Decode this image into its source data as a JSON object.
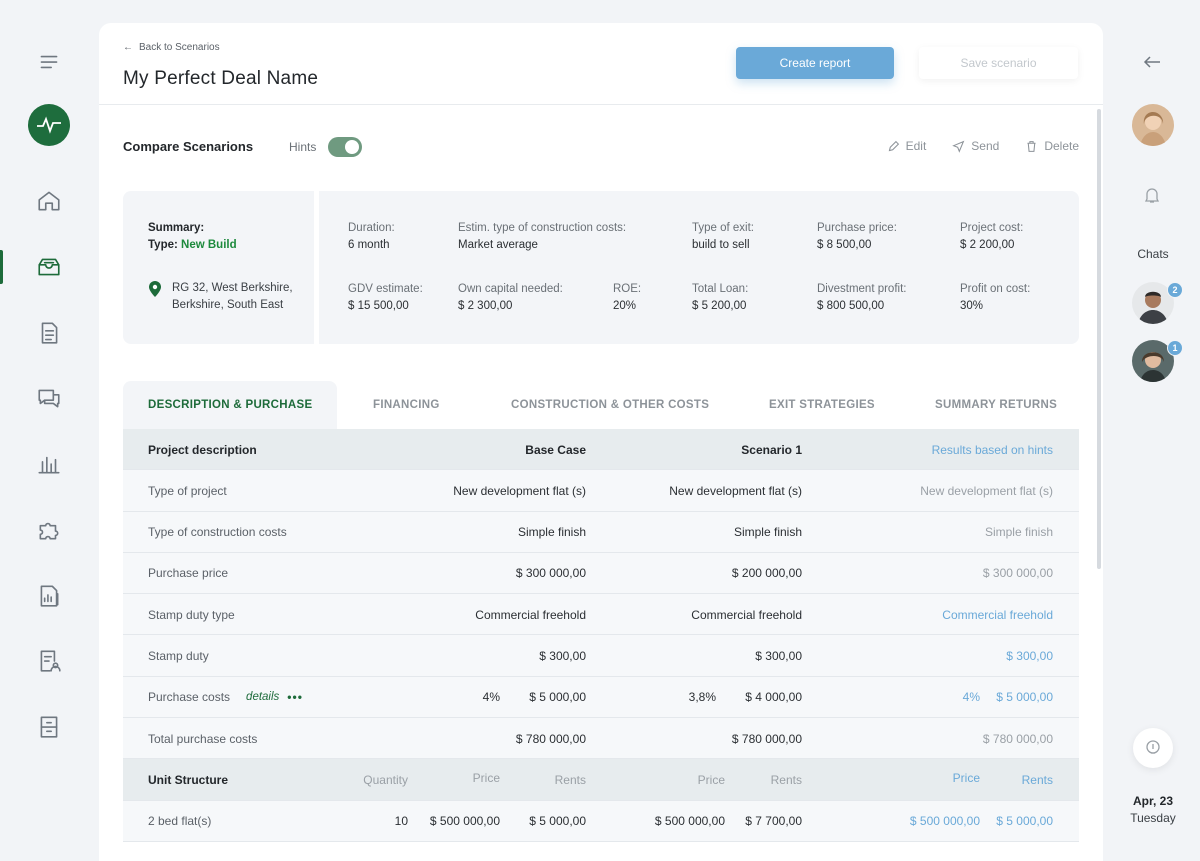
{
  "nav": {
    "items": [
      "menu",
      "home",
      "deals",
      "documents",
      "messages",
      "analytics",
      "puzzle",
      "reports",
      "profile",
      "archive"
    ]
  },
  "header": {
    "back_label": "Back to Scenarios",
    "title": "My Perfect Deal Name",
    "create_report_label": "Create report",
    "save_scenario_label": "Save scenario"
  },
  "compare": {
    "title": "Compare Scenarions",
    "hints_label": "Hints",
    "hints_enabled": true,
    "edit_label": "Edit",
    "send_label": "Send",
    "delete_label": "Delete"
  },
  "summary": {
    "summary_label": "Summary:",
    "type_label": "Type:",
    "type_value": "New Build",
    "address_line1": "RG 32, West Berkshire,",
    "address_line2": "Berkshire, South East",
    "fields": [
      {
        "k": "Duration:",
        "v": "6 month"
      },
      {
        "k": "Estim. type of construction costs:",
        "v": "Market average"
      },
      {
        "k": "Type of exit:",
        "v": "build to sell"
      },
      {
        "k": "Purchase price:",
        "v": "$ 8 500,00"
      },
      {
        "k": "Project cost:",
        "v": "$ 2 200,00"
      },
      {
        "k": "GDV estimate:",
        "v": "$ 15 500,00"
      },
      {
        "k": "Own capital needed:",
        "v": "$ 2 300,00"
      },
      {
        "k": "ROE:",
        "v": "20%"
      },
      {
        "k": "Total Loan:",
        "v": "$ 5 200,00"
      },
      {
        "k": "Divestment profit:",
        "v": "$ 800 500,00"
      },
      {
        "k": "Profit on cost:",
        "v": "30%"
      }
    ]
  },
  "tabs": [
    "DESCRIPTION & PURCHASE",
    "FINANCING",
    "CONSTRUCTION & OTHER COSTS",
    "EXIT STRATEGIES",
    "SUMMARY RETURNS"
  ],
  "table": {
    "header": {
      "label": "Project description",
      "base": "Base Case",
      "s1": "Scenario 1",
      "hints": "Results based on hints"
    },
    "rows": [
      {
        "label": "Type of project",
        "base": "New development flat (s)",
        "s1": "New development flat (s)",
        "hints": "New development flat (s)"
      },
      {
        "label": "Type of construction costs",
        "base": "Simple finish",
        "s1": "Simple finish",
        "hints": "Simple finish"
      },
      {
        "label": "Purchase price",
        "base": "$ 300 000,00",
        "s1": "$ 200 000,00",
        "hints": "$ 300 000,00"
      },
      {
        "label": "Stamp duty type",
        "base": "Commercial freehold",
        "s1": "Commercial freehold",
        "hints": "Commercial freehold"
      },
      {
        "label": "Stamp duty",
        "base": "$ 300,00",
        "s1": "$ 300,00",
        "hints": "$ 300,00"
      },
      {
        "label": "Purchase costs",
        "details": "details",
        "dots": "•••",
        "base_pct": "4%",
        "base": "$ 5 000,00",
        "s1_pct": "3,8%",
        "s1": "$ 4 000,00",
        "hints_pct": "4%",
        "hints": "$ 5 000,00"
      },
      {
        "label": "Total purchase costs",
        "base": "$ 780 000,00",
        "s1": "$ 780 000,00",
        "hints": "$ 780 000,00"
      }
    ],
    "unit_header": {
      "label": "Unit Structure",
      "quantity": "Quantity",
      "price": "Price",
      "rents": "Rents"
    },
    "unit_rows": [
      {
        "label": "2 bed flat(s)",
        "qty": "10",
        "base_price": "$ 500 000,00",
        "base_rent": "$ 5 000,00",
        "s1_price": "$ 500 000,00",
        "s1_rent": "$ 7 700,00",
        "h_price": "$ 500 000,00",
        "h_rent": "$ 5 000,00"
      }
    ]
  },
  "right": {
    "chats_label": "Chats",
    "badge1": "2",
    "badge2": "1",
    "date": "Apr, 23",
    "day": "Tuesday"
  },
  "colors": {
    "accent_green": "#1d6b3a",
    "accent_blue": "#6aa9d8"
  }
}
